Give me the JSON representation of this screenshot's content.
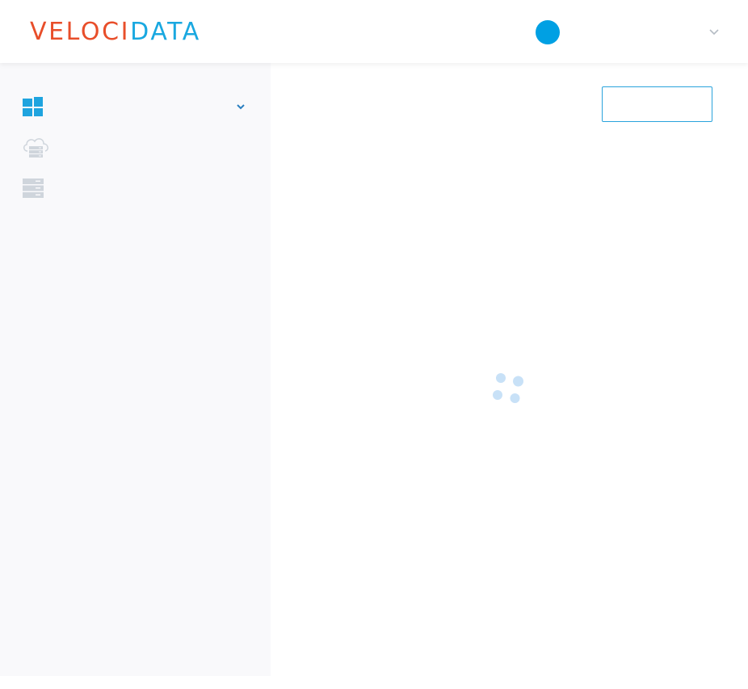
{
  "header": {
    "logo": {
      "part1": "VELOCI",
      "part2": "DATA"
    },
    "user": {
      "avatar_color": "#00a0e3",
      "menu_icon": "chevron-down-icon"
    }
  },
  "sidebar": {
    "items": [
      {
        "icon": "dashboard-grid-icon",
        "expanded": true,
        "expand_icon": "chevron-down-icon"
      },
      {
        "icon": "cloud-server-icon"
      },
      {
        "icon": "server-stack-icon"
      }
    ]
  },
  "main": {
    "action_button": {
      "label": ""
    },
    "loading": true
  },
  "colors": {
    "brand_orange": "#e84e2a",
    "brand_blue": "#19a8e0",
    "accent": "#00a0e3",
    "spinner": "#c8e1f7",
    "icon_gray": "#d0d5db"
  }
}
